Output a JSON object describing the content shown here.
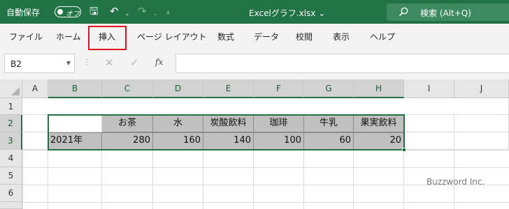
{
  "titlebar": {
    "autosave_label": "自動保存",
    "autosave_state": "オフ",
    "save_glyph": "🖫",
    "undo_glyph": "↶",
    "dropdown_glyph": "⌄",
    "redo_glyph": "↷",
    "customize_glyph": "⩡",
    "document_title": "Excelグラフ.xlsx ⌄",
    "search_placeholder": "検索 (Alt+Q)",
    "bg_color": "#217346"
  },
  "ribbon": {
    "tabs": [
      "ファイル",
      "ホーム",
      "挿入",
      "ページ レイアウト",
      "数式",
      "データ",
      "校閲",
      "表示",
      "ヘルプ"
    ],
    "highlighted_tab": "挿入",
    "highlight_color": "#e0151c"
  },
  "formula_bar": {
    "name_box": "B2",
    "cancel_glyph": "✕",
    "enter_glyph": "✓",
    "fx_label": "fx",
    "formula": ""
  },
  "sheet": {
    "columns": [
      "A",
      "B",
      "C",
      "D",
      "E",
      "F",
      "G",
      "H",
      "I",
      "J"
    ],
    "selected_columns": [
      "B",
      "C",
      "D",
      "E",
      "F",
      "G",
      "H"
    ],
    "rows": [
      "1",
      "2",
      "3",
      "4",
      "5",
      "6"
    ],
    "selected_rows": [
      "2",
      "3"
    ],
    "header_row": [
      "",
      "お茶",
      "水",
      "炭酸飲料",
      "珈琲",
      "牛乳",
      "果実飲料"
    ],
    "data_row": [
      "2021年",
      "280",
      "160",
      "140",
      "100",
      "60",
      "20"
    ],
    "selected_range": "B2:H3",
    "selection_color": "#217346"
  },
  "watermark": "Buzzword Inc."
}
